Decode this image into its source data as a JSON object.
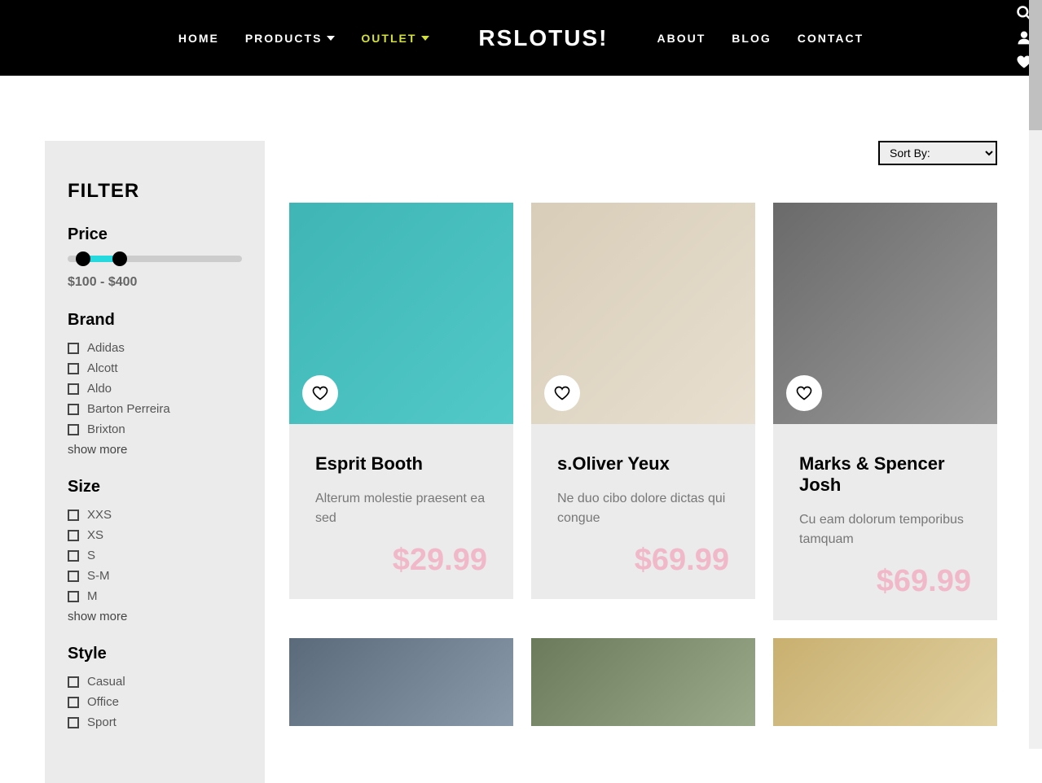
{
  "header": {
    "logo": "RSLOTUS!",
    "nav_left": [
      {
        "label": "HOME",
        "caret": false,
        "active": false
      },
      {
        "label": "PRODUCTS",
        "caret": true,
        "active": false
      },
      {
        "label": "OUTLET",
        "caret": true,
        "active": true
      }
    ],
    "nav_right": [
      {
        "label": "ABOUT"
      },
      {
        "label": "BLOG"
      },
      {
        "label": "CONTACT"
      }
    ]
  },
  "filter": {
    "title": "FILTER",
    "price": {
      "heading": "Price",
      "range_text": "$100 - $400"
    },
    "brand": {
      "heading": "Brand",
      "items": [
        "Adidas",
        "Alcott",
        "Aldo",
        "Barton Perreira",
        "Brixton"
      ],
      "show_more": "show more"
    },
    "size": {
      "heading": "Size",
      "items": [
        "XXS",
        "XS",
        "S",
        "S-M",
        "M"
      ],
      "show_more": "show more"
    },
    "style": {
      "heading": "Style",
      "items": [
        "Casual",
        "Office",
        "Sport"
      ]
    }
  },
  "sort": {
    "label": "Sort By:"
  },
  "products": [
    {
      "title": "Esprit Booth",
      "desc": "Alterum molestie praesent ea sed",
      "price": "$29.99"
    },
    {
      "title": "s.Oliver Yeux",
      "desc": "Ne duo cibo dolore dictas qui congue",
      "price": "$69.99"
    },
    {
      "title": "Marks & Spencer Josh",
      "desc": "Cu eam dolorum temporibus tamquam",
      "price": "$69.99"
    }
  ]
}
